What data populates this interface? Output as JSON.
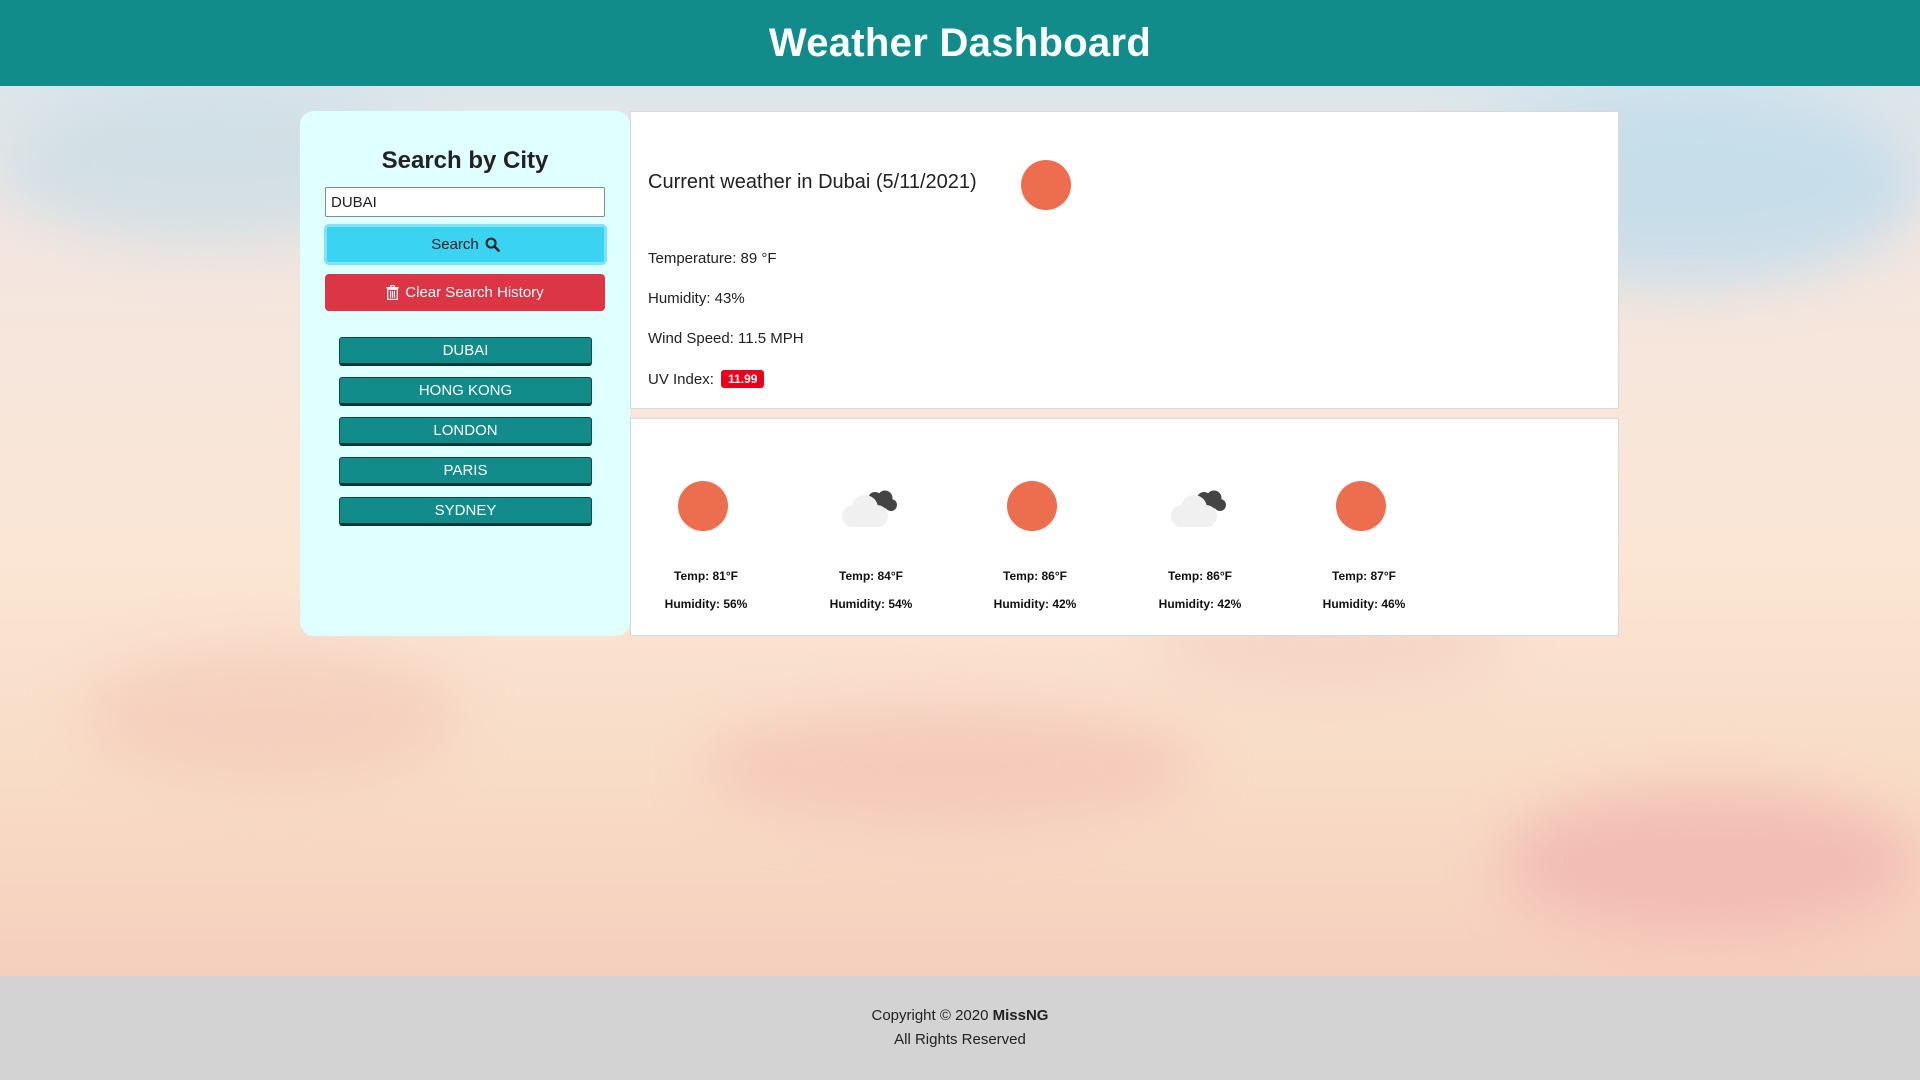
{
  "header": {
    "title": "Weather Dashboard"
  },
  "sidebar": {
    "heading": "Search by City",
    "search_value": "DUBAI",
    "search_button_label": "Search",
    "clear_button_label": "Clear Search History",
    "history": [
      "DUBAI",
      "HONG KONG",
      "LONDON",
      "PARIS",
      "SYDNEY"
    ]
  },
  "current": {
    "title": "Current weather in Dubai (5/11/2021)",
    "icon": "sun-icon",
    "temperature": "Temperature: 89 °F",
    "humidity": "Humidity: 43%",
    "wind": "Wind Speed: 11.5 MPH",
    "uv_label": "UV Index:",
    "uv_value": "11.99"
  },
  "forecast": [
    {
      "icon": "sun-icon",
      "temp": "Temp: 81°F",
      "humidity": "Humidity: 56%"
    },
    {
      "icon": "cloud-icon",
      "temp": "Temp: 84°F",
      "humidity": "Humidity: 54%"
    },
    {
      "icon": "sun-icon",
      "temp": "Temp: 86°F",
      "humidity": "Humidity: 42%"
    },
    {
      "icon": "cloud-icon",
      "temp": "Temp: 86°F",
      "humidity": "Humidity: 42%"
    },
    {
      "icon": "sun-icon",
      "temp": "Temp: 87°F",
      "humidity": "Humidity: 46%"
    }
  ],
  "footer": {
    "copyright_prefix": "Copyright © 2020",
    "author": "MissNG",
    "rights": "All Rights Reserved"
  },
  "colors": {
    "header": "#128b8b",
    "sun": "#ec6e4f",
    "uv_badge": "#e8001c",
    "search_button": "#3ad4f2",
    "clear_button": "#dc3545"
  }
}
